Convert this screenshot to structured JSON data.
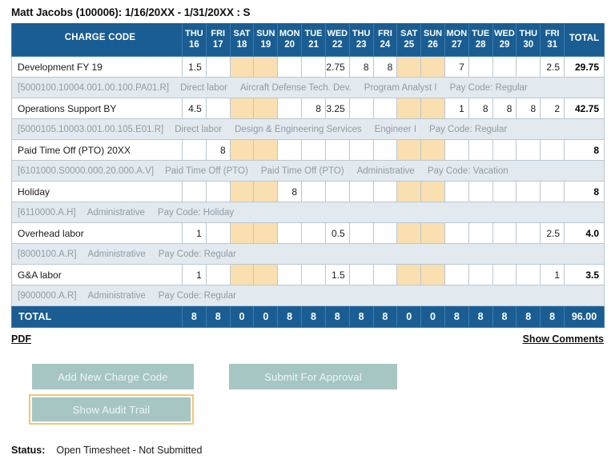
{
  "header": {
    "title": "Matt Jacobs (100006): 1/16/20XX - 1/31/20XX : S"
  },
  "table": {
    "charge_code_header": "CHARGE CODE",
    "total_header": "TOTAL",
    "days": [
      {
        "dow": "THU",
        "num": "16",
        "weekend": false
      },
      {
        "dow": "FRI",
        "num": "17",
        "weekend": false
      },
      {
        "dow": "SAT",
        "num": "18",
        "weekend": true
      },
      {
        "dow": "SUN",
        "num": "19",
        "weekend": true
      },
      {
        "dow": "MON",
        "num": "20",
        "weekend": false
      },
      {
        "dow": "TUE",
        "num": "21",
        "weekend": false
      },
      {
        "dow": "WED",
        "num": "22",
        "weekend": false
      },
      {
        "dow": "THU",
        "num": "23",
        "weekend": false
      },
      {
        "dow": "FRI",
        "num": "24",
        "weekend": false
      },
      {
        "dow": "SAT",
        "num": "25",
        "weekend": true
      },
      {
        "dow": "SUN",
        "num": "26",
        "weekend": true
      },
      {
        "dow": "MON",
        "num": "27",
        "weekend": false
      },
      {
        "dow": "TUE",
        "num": "28",
        "weekend": false
      },
      {
        "dow": "WED",
        "num": "29",
        "weekend": false
      },
      {
        "dow": "THU",
        "num": "30",
        "weekend": false
      },
      {
        "dow": "FRI",
        "num": "31",
        "weekend": false
      }
    ],
    "rows": [
      {
        "charge_code": "Development FY 19",
        "hours": [
          "1.5",
          "",
          "",
          "",
          "",
          "",
          "2.75",
          "8",
          "8",
          "",
          "",
          "7",
          "",
          "",
          "",
          "2.5"
        ],
        "total": "29.75",
        "detail": {
          "account": "[5000100.10004.001.00.100.PA01.R]",
          "d1": "Direct labor",
          "d2": "Aircraft Defense Tech. Dev.",
          "d3": "Program Analyst I",
          "d4": "Pay Code: Regular"
        }
      },
      {
        "charge_code": "Operations Support BY",
        "hours": [
          "4.5",
          "",
          "",
          "",
          "",
          "8",
          "3.25",
          "",
          "",
          "",
          "",
          "1",
          "8",
          "8",
          "8",
          "2"
        ],
        "total": "42.75",
        "detail": {
          "account": "[5000105.10003.001.00.105.E01.R]",
          "d1": "Direct labor",
          "d2": "Design & Engineering Services",
          "d3": "Engineer I",
          "d4": "Pay Code: Regular"
        }
      },
      {
        "charge_code": "Paid Time Off (PTO) 20XX",
        "hours": [
          "",
          "8",
          "",
          "",
          "",
          "",
          "",
          "",
          "",
          "",
          "",
          "",
          "",
          "",
          "",
          ""
        ],
        "total": "8",
        "detail": {
          "account": "[6101000.S0000.000.20.000.A.V]",
          "d1": "Paid Time Off (PTO)",
          "d2": "Paid Time Off (PTO)",
          "d3": "Administrative",
          "d4": "Pay Code: Vacation"
        }
      },
      {
        "charge_code": "Holiday",
        "hours": [
          "",
          "",
          "",
          "",
          "8",
          "",
          "",
          "",
          "",
          "",
          "",
          "",
          "",
          "",
          "",
          ""
        ],
        "total": "8",
        "detail": {
          "account": "[6110000.A.H]",
          "d1": "Administrative",
          "d2": "Pay Code: Holiday",
          "d3": "",
          "d4": ""
        }
      },
      {
        "charge_code": "Overhead labor",
        "hours": [
          "1",
          "",
          "",
          "",
          "",
          "",
          "0.5",
          "",
          "",
          "",
          "",
          "",
          "",
          "",
          "",
          "2.5"
        ],
        "total": "4.0",
        "detail": {
          "account": "[8000100.A.R]",
          "d1": "Administrative",
          "d2": "Pay Code: Regular",
          "d3": "",
          "d4": ""
        }
      },
      {
        "charge_code": "G&A labor",
        "hours": [
          "1",
          "",
          "",
          "",
          "",
          "",
          "1.5",
          "",
          "",
          "",
          "",
          "",
          "",
          "",
          "",
          "1"
        ],
        "total": "3.5",
        "detail": {
          "account": "[9000000.A.R]",
          "d1": "Administrative",
          "d2": "Pay Code: Regular",
          "d3": "",
          "d4": ""
        }
      }
    ],
    "grand_total_row": {
      "label": "TOTAL",
      "day_totals": [
        "8",
        "8",
        "0",
        "0",
        "8",
        "8",
        "8",
        "8",
        "8",
        "0",
        "0",
        "8",
        "8",
        "8",
        "8",
        "8"
      ],
      "total": "96.00"
    }
  },
  "links": {
    "pdf": "PDF",
    "show_comments": "Show Comments"
  },
  "buttons": {
    "add_charge_code": "Add New Charge Code",
    "submit_for_approval": "Submit For Approval",
    "show_audit_trail": "Show Audit Trail"
  },
  "status": {
    "label": "Status:",
    "value": "Open Timesheet - Not Submitted"
  },
  "colors": {
    "header_blue": "#1a5d92",
    "weekend_tan": "#fadfb0",
    "detail_gray": "#e2eaef",
    "button_teal": "#a5c6c2",
    "focus_orange": "#f2c679"
  }
}
